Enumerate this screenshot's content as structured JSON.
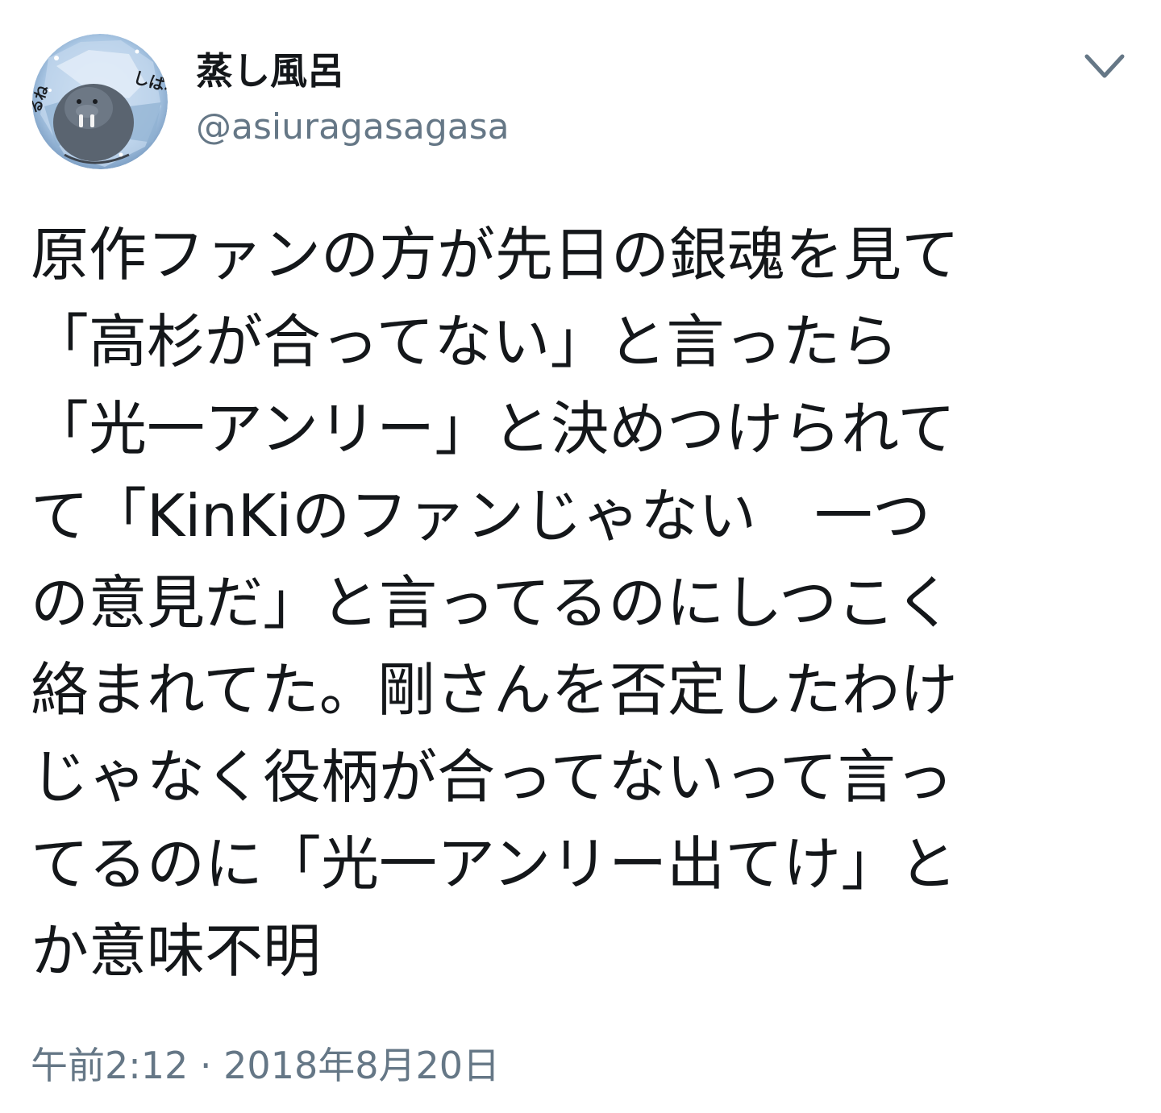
{
  "user": {
    "display_name": "蒸し風呂",
    "handle": "@asiuragasagasa",
    "avatar_icon": "walrus-avatar-icon",
    "avatar_text_right": "しばわ",
    "avatar_text_left": "るね"
  },
  "menu": {
    "icon": "chevron-down-icon"
  },
  "tweet": {
    "lines": [
      "原作ファンの方が先日の銀魂を見て",
      "「高杉が合ってない」と言ったら",
      "「光一アンリー」と決めつけられて",
      "て「KinKiのファンじゃない　一つ",
      "の意見だ」と言ってるのにしつこく",
      "絡まれてた。剛さんを否定したわけ",
      "じゃなく役柄が合ってないって言っ",
      "てるのに「光一アンリー出てけ」と",
      "か意味不明"
    ],
    "timestamp": "午前2:12 · 2018年8月20日"
  },
  "colors": {
    "text": "#14171a",
    "secondary": "#657786",
    "background": "#ffffff"
  }
}
